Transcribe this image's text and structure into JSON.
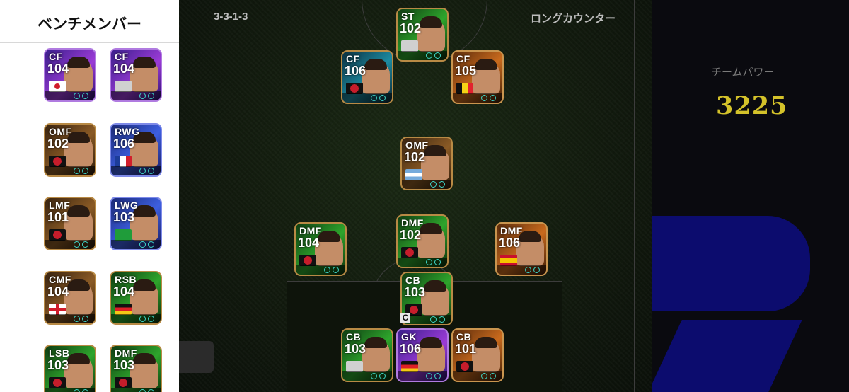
{
  "bench": {
    "title": "ベンチメンバー",
    "players": [
      {
        "position": "CF",
        "rating": "104",
        "style": "bg-purple",
        "badge": "flag-jp",
        "badge_name": "japan-flag-icon"
      },
      {
        "position": "CF",
        "rating": "104",
        "style": "bg-purple",
        "badge": "crest-gray",
        "badge_name": "club-crest-icon"
      },
      {
        "position": "OMF",
        "rating": "102",
        "style": "bg-gold",
        "badge": "crest",
        "badge_name": "ac-milan-crest-icon"
      },
      {
        "position": "RWG",
        "rating": "106",
        "style": "bg-blue",
        "badge": "flag-fr",
        "badge_name": "france-flag-icon"
      },
      {
        "position": "LMF",
        "rating": "101",
        "style": "bg-gold",
        "badge": "crest",
        "badge_name": "ac-milan-crest-icon"
      },
      {
        "position": "LWG",
        "rating": "103",
        "style": "bg-blue",
        "badge": "flag-br",
        "badge_name": "brazil-flag-icon"
      },
      {
        "position": "CMF",
        "rating": "104",
        "style": "bg-gold",
        "badge": "flag-en",
        "badge_name": "england-flag-icon"
      },
      {
        "position": "RSB",
        "rating": "104",
        "style": "bg-green",
        "badge": "flag-de",
        "badge_name": "germany-flag-icon"
      },
      {
        "position": "LSB",
        "rating": "103",
        "style": "bg-green",
        "badge": "crest",
        "badge_name": "ac-milan-crest-icon"
      },
      {
        "position": "DMF",
        "rating": "103",
        "style": "bg-green",
        "badge": "crest",
        "badge_name": "ac-milan-crest-icon"
      }
    ]
  },
  "formation": "3-3-1-3",
  "tactic": "ロングカウンター",
  "team_power": {
    "label": "チームパワー",
    "value": "3225"
  },
  "captain_mark": "C",
  "lineup": [
    {
      "position": "ST",
      "rating": "102",
      "style": "bg-green",
      "badge": "crest-gray",
      "badge_name": "club-crest-icon"
    },
    {
      "position": "CF",
      "rating": "106",
      "style": "bg-teal",
      "badge": "crest",
      "badge_name": "club-crest-icon"
    },
    {
      "position": "CF",
      "rating": "105",
      "style": "bg-orange",
      "badge": "flag-be",
      "badge_name": "belgium-flag-icon"
    },
    {
      "position": "OMF",
      "rating": "102",
      "style": "bg-gold",
      "badge": "flag-ar",
      "badge_name": "argentina-flag-icon"
    },
    {
      "position": "DMF",
      "rating": "104",
      "style": "bg-green",
      "badge": "crest",
      "badge_name": "ac-milan-crest-icon"
    },
    {
      "position": "DMF",
      "rating": "102",
      "style": "bg-green",
      "badge": "crest",
      "badge_name": "arsenal-crest-icon"
    },
    {
      "position": "DMF",
      "rating": "106",
      "style": "bg-orange",
      "badge": "flag-es",
      "badge_name": "spain-flag-icon"
    },
    {
      "position": "CB",
      "rating": "103",
      "style": "bg-green",
      "badge": "crest",
      "badge_name": "ac-milan-crest-icon"
    },
    {
      "position": "CB",
      "rating": "103",
      "style": "bg-green",
      "badge": "crest-gray",
      "badge_name": "club-crest-icon"
    },
    {
      "position": "GK",
      "rating": "106",
      "style": "bg-purple",
      "badge": "flag-de",
      "badge_name": "germany-flag-icon"
    },
    {
      "position": "CB",
      "rating": "101",
      "style": "bg-orange",
      "badge": "crest",
      "badge_name": "barcelona-crest-icon"
    }
  ]
}
